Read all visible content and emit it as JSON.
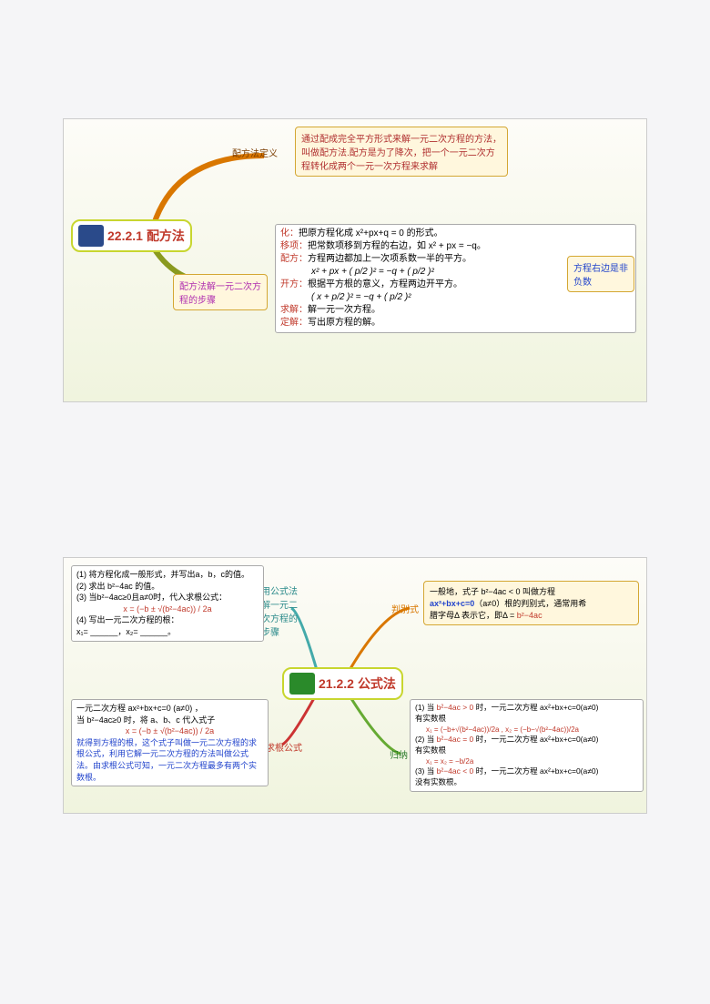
{
  "s1": {
    "title": {
      "num": "22.2.1",
      "name": "配方法"
    },
    "branch1": "配方法定义",
    "def": "通过配成完全平方形式来解一元二次方程的方法，叫做配方法.配方是为了降次，把一个一元二次方程转化成两个一元一次方程来求解",
    "branch2": "配方法解一元二次方程的步骤",
    "steps": {
      "hua": {
        "k": "化：",
        "v": "把原方程化成 x²+px+q = 0 的形式。"
      },
      "yi": {
        "k": "移项：",
        "v": "把常数项移到方程的右边，如 x² + px = −q。"
      },
      "pei": {
        "k": "配方：",
        "v": "方程两边都加上一次项系数一半的平方。",
        "eq": "x² + px + ( p/2 )² = −q + ( p/2 )²"
      },
      "kai": {
        "k": "开方：",
        "v": "根据平方根的意义，方程两边开平方。",
        "eq": "( x + p/2 )² = −q + ( p/2 )²"
      },
      "qiu": {
        "k": "求解：",
        "v": "解一元一次方程。"
      },
      "ding": {
        "k": "定解：",
        "v": "写出原方程的解。"
      },
      "note": "方程右边是非负数"
    }
  },
  "s2": {
    "title": {
      "num": "21.2.2",
      "name": "公式法"
    },
    "br": {
      "a": "用公式法解一元二次方程的步骤",
      "b": "判别式",
      "c": "求根公式",
      "d": "归纳"
    },
    "proc": {
      "l1": "(1) 将方程化成一般形式，并写出a，b，c的值。",
      "l2": "(2) 求出 b²−4ac 的值。",
      "l3": "(3) 当b²−4ac≥0且a≠0时，代入求根公式：",
      "eq": "x = (−b ± √(b²−4ac)) / 2a",
      "l4": "(4) 写出一元二次方程的根：",
      "l5": "x₁= ______，x₂= ______。"
    },
    "det": {
      "l1": "一般地，式子 b²−4ac < 0 叫做方程",
      "l2a": "ax²+bx+c=0",
      "l2b": "（a≠0）根的判别式，通常用希",
      "l3a": "腊字母Δ 表示它，即Δ = ",
      "l3b": "b²−4ac"
    },
    "root": {
      "l1": "一元二次方程 ax²+bx+c=0   (a≠0) ，",
      "l2": "当 b²−4ac≥0 时，将 a、b、c 代入式子",
      "eq": "x = (−b ± √(b²−4ac)) / 2a",
      "l3": "就得到方程的根，这个式子叫做一元二次方程的求根公式，利用它解一元二次方程的方法叫做公式法。由求根公式可知，一元二次方程最多有两个实数根。"
    },
    "sum": {
      "a1": "(1) 当",
      "a2": "b²−4ac > 0",
      "a3": "时，一元二次方程 ax²+bx+c=0(a≠0)",
      "a4": "有实数根",
      "eq1": "x₁ = (−b+√(b²−4ac))/2a ,  x₂ = (−b−√(b²−4ac))/2a",
      "b1": "(2) 当",
      "b2": "b²−4ac = 0",
      "b3": "时，一元二次方程 ax²+bx+c=0(a≠0)",
      "b4": "有实数根",
      "eq2": "x₁ = x₂ = −b/2a",
      "c1": "(3) 当",
      "c2": "b²−4ac < 0",
      "c3": "时，一元二次方程 ax²+bx+c=0(a≠0)",
      "c4": "没有实数根。"
    }
  }
}
